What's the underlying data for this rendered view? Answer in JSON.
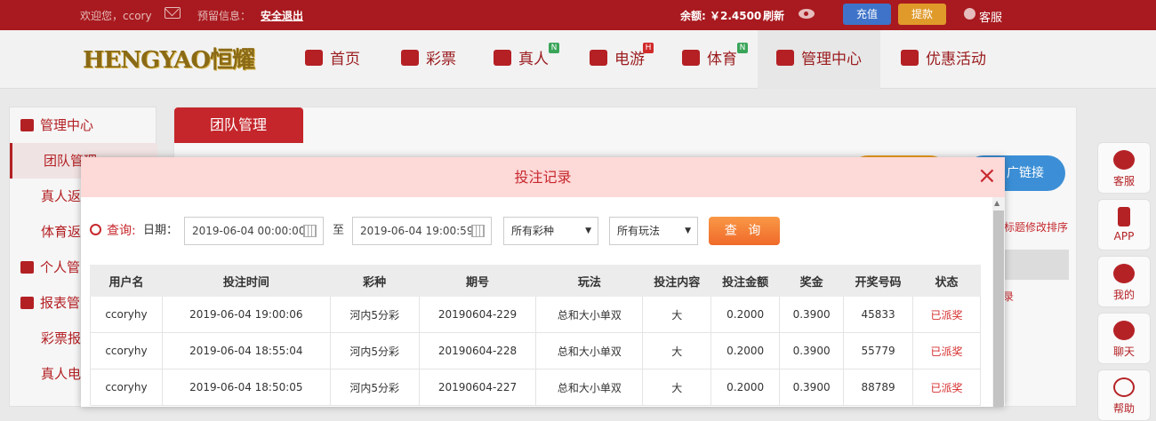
{
  "topbar": {
    "welcome": "欢迎您，ccory",
    "reserve_label": "预留信息：",
    "logout": "安全退出",
    "balance": "余额: ￥2.4500",
    "refresh": "刷新",
    "deposit": "充值",
    "withdraw": "提款",
    "customer_service": "客服"
  },
  "logo": "HENGYAO恒耀",
  "nav": {
    "items": [
      {
        "label": "首页",
        "icon": "home-icon"
      },
      {
        "label": "彩票",
        "icon": "ticket-icon"
      },
      {
        "label": "真人",
        "icon": "person-icon",
        "badge": "N"
      },
      {
        "label": "电游",
        "icon": "slot-machine-icon",
        "badge": "H"
      },
      {
        "label": "体育",
        "icon": "trophy-icon",
        "badge": "N"
      },
      {
        "label": "管理中心",
        "icon": "users-icon"
      },
      {
        "label": "优惠活动",
        "icon": "gift-icon"
      }
    ]
  },
  "sidebar": {
    "items": [
      {
        "label": "管理中心",
        "type": "head"
      },
      {
        "label": "团队管理",
        "type": "sub"
      },
      {
        "label": "真人返",
        "type": "sub"
      },
      {
        "label": "体育返",
        "type": "sub"
      },
      {
        "label": "个人管",
        "type": "head"
      },
      {
        "label": "报表管",
        "type": "head"
      },
      {
        "label": "彩票报",
        "type": "sub"
      },
      {
        "label": "真人电",
        "type": "sub"
      }
    ]
  },
  "main": {
    "tab": "团队管理",
    "promo_link": "广链接",
    "sort_hint": "标题修改排序",
    "partial_cell": "录"
  },
  "rightbar": {
    "items": [
      "客服",
      "APP",
      "我的",
      "聊天",
      "帮助"
    ]
  },
  "modal": {
    "title": "投注记录",
    "close": "×",
    "query_label": "查询:",
    "date_label": "日期：",
    "date_from": "2019-06-04 00:00:00",
    "to_label": "至",
    "date_to": "2019-06-04 19:00:59",
    "lottery_select": "所有彩种",
    "play_select": "所有玩法",
    "search_button": "查 询",
    "table": {
      "headers": [
        "用户名",
        "投注时间",
        "彩种",
        "期号",
        "玩法",
        "投注内容",
        "投注金额",
        "奖金",
        "开奖号码",
        "状态"
      ],
      "rows": [
        [
          "ccoryhy",
          "2019-06-04 19:00:06",
          "河内5分彩",
          "20190604-229",
          "总和大小单双",
          "大",
          "0.2000",
          "0.3900",
          "45833",
          "已派奖"
        ],
        [
          "ccoryhy",
          "2019-06-04 18:55:04",
          "河内5分彩",
          "20190604-228",
          "总和大小单双",
          "大",
          "0.2000",
          "0.3900",
          "55779",
          "已派奖"
        ],
        [
          "ccoryhy",
          "2019-06-04 18:50:05",
          "河内5分彩",
          "20190604-227",
          "总和大小单双",
          "大",
          "0.2000",
          "0.3900",
          "88789",
          "已派奖"
        ]
      ]
    }
  }
}
